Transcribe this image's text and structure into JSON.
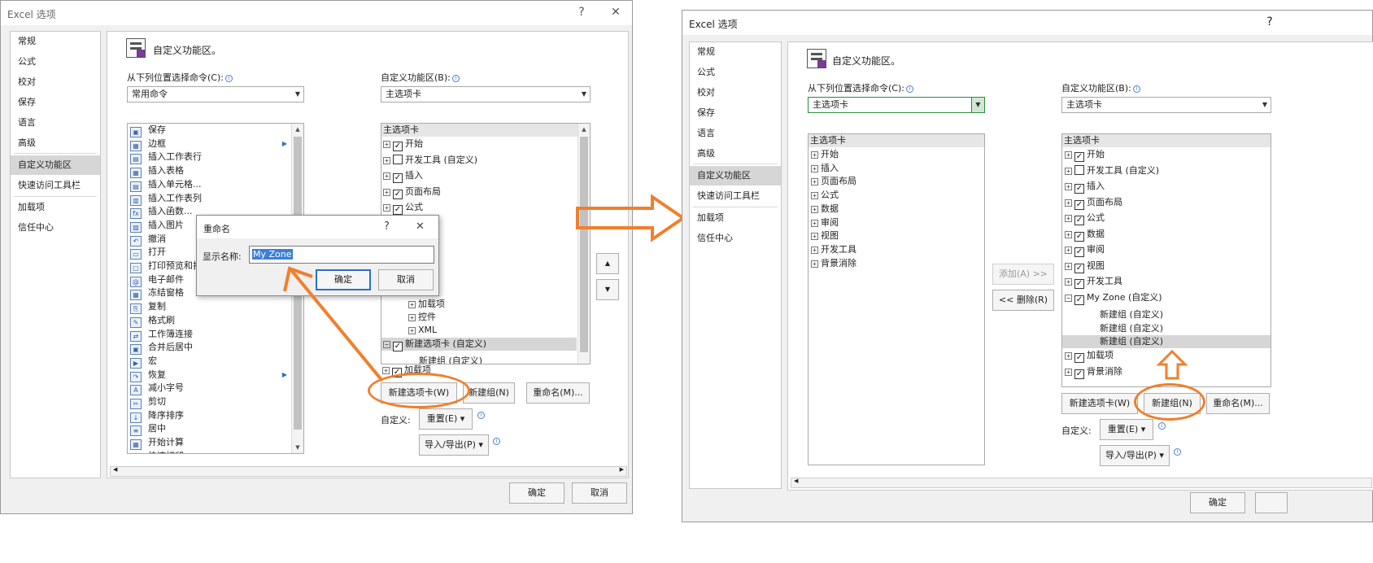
{
  "dialog_title": "Excel 选项",
  "help_glyph": "?",
  "close_glyph": "✕",
  "nav_items": [
    "常规",
    "公式",
    "校对",
    "保存",
    "语言",
    "高级",
    "自定义功能区",
    "快速访问工具栏",
    "加载项",
    "信任中心"
  ],
  "section_title": "自定义功能区。",
  "choose_from_label": "从下列位置选择命令(C):",
  "customize_ribbon_label": "自定义功能区(B):",
  "left": {
    "choose_combo": "常用命令",
    "ribbon_combo": "主选项卡",
    "commands": [
      "保存",
      "边框",
      "插入工作表行",
      "插入表格",
      "插入单元格...",
      "插入工作表列",
      "插入函数...",
      "插入图片",
      "撤消",
      "打开",
      "打印预览和打印",
      "电子邮件",
      "冻结窗格",
      "复制",
      "格式刷",
      "工作簿连接",
      "合并后居中",
      "宏",
      "恢复",
      "减小字号",
      "剪切",
      "降序排序",
      "居中",
      "开始计算",
      "快速打印"
    ],
    "tree": {
      "header": "主选项卡",
      "top_tabs": [
        {
          "label": "开始",
          "checked": true
        },
        {
          "label": "开发工具 (自定义)",
          "checked": false
        },
        {
          "label": "插入",
          "checked": true
        },
        {
          "label": "页面布局",
          "checked": true
        },
        {
          "label": "公式",
          "checked": true
        }
      ],
      "sub_groups": [
        "加载项",
        "控件",
        "XML"
      ],
      "new_tab": "新建选项卡 (自定义)",
      "new_group": "新建组 (自定义)",
      "addins_tab": "加载项"
    },
    "buttons": {
      "new_tab": "新建选项卡(W)",
      "new_group": "新建组(N)",
      "rename": "重命名(M)..."
    },
    "customize_label": "自定义:",
    "reset": "重置(E) ▾",
    "import_export": "导入/导出(P) ▾",
    "ok": "确定",
    "cancel": "取消",
    "rename_dialog": {
      "title": "重命名",
      "help": "?",
      "close": "✕",
      "display_name_label": "显示名称:",
      "display_name_value": "My Zone",
      "ok": "确定",
      "cancel": "取消"
    }
  },
  "right": {
    "choose_combo": "主选项卡",
    "ribbon_combo": "主选项卡",
    "source_header": "主选项卡",
    "source_tabs": [
      "开始",
      "插入",
      "页面布局",
      "公式",
      "数据",
      "审阅",
      "视图",
      "开发工具",
      "背景消除"
    ],
    "add_button": "添加(A) >>",
    "remove_button": "<< 删除(R)",
    "ribbon_header": "主选项卡",
    "ribbon_tabs": [
      {
        "label": "开始",
        "checked": true
      },
      {
        "label": "开发工具 (自定义)",
        "checked": false
      },
      {
        "label": "插入",
        "checked": true
      },
      {
        "label": "页面布局",
        "checked": true
      },
      {
        "label": "公式",
        "checked": true
      },
      {
        "label": "数据",
        "checked": true
      },
      {
        "label": "审阅",
        "checked": true
      },
      {
        "label": "视图",
        "checked": true
      },
      {
        "label": "开发工具",
        "checked": true
      },
      {
        "label": "My Zone (自定义)",
        "checked": true
      }
    ],
    "zone_groups": [
      "新建组 (自定义)",
      "新建组 (自定义)",
      "新建组 (自定义)"
    ],
    "tail_tabs": [
      {
        "label": "加载项",
        "checked": true
      },
      {
        "label": "背景消除",
        "checked": true
      }
    ],
    "buttons": {
      "new_tab": "新建选项卡(W)",
      "new_group": "新建组(N)",
      "rename": "重命名(M)..."
    },
    "customize_label": "自定义:",
    "reset": "重置(E) ▾",
    "import_export": "导入/导出(P) ▾",
    "ok": "确定"
  },
  "colors": {
    "annotation": "#f07f2d",
    "selection": "#d6d6d6",
    "focus_blue": "#2b6ec9"
  }
}
